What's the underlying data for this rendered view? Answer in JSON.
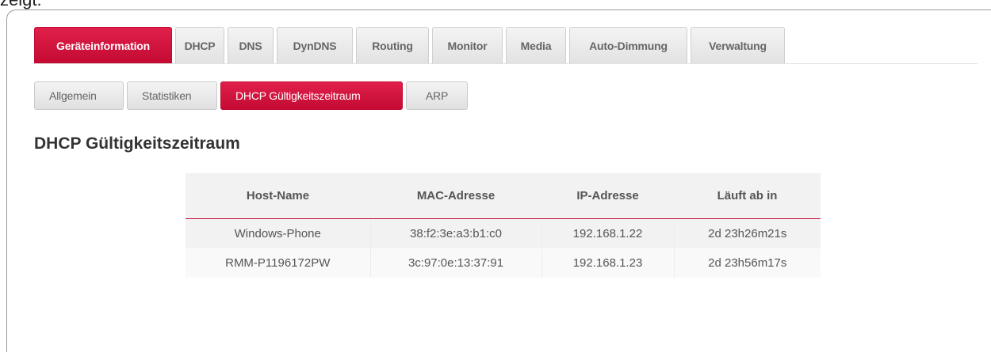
{
  "caption_fragment": "zeigt:",
  "main_tabs": [
    {
      "label": "Geräteinformation",
      "active": true
    },
    {
      "label": "DHCP",
      "active": false
    },
    {
      "label": "DNS",
      "active": false
    },
    {
      "label": "DynDNS",
      "active": false
    },
    {
      "label": "Routing",
      "active": false
    },
    {
      "label": "Monitor",
      "active": false
    },
    {
      "label": "Media",
      "active": false
    },
    {
      "label": "Auto-Dimmung",
      "active": false
    },
    {
      "label": "Verwaltung",
      "active": false
    }
  ],
  "sub_tabs": [
    {
      "label": "Allgemein",
      "active": false
    },
    {
      "label": "Statistiken",
      "active": false
    },
    {
      "label": "DHCP Gültigkeitszeitraum",
      "active": true
    },
    {
      "label": "ARP",
      "active": false
    }
  ],
  "section_title": "DHCP Gültigkeitszeitraum",
  "table": {
    "headers": [
      "Host-Name",
      "MAC-Adresse",
      "IP-Adresse",
      "Läuft ab in"
    ],
    "rows": [
      [
        "Windows-Phone",
        "38:f2:3e:a3:b1:c0",
        "192.168.1.22",
        "2d 23h26m21s"
      ],
      [
        "RMM-P1196172PW",
        "3c:97:0e:13:37:91",
        "192.168.1.23",
        "2d 23h56m17s"
      ]
    ]
  },
  "colors": {
    "accent": "#c30a32",
    "tab_inactive": "#e6e6e6",
    "text": "#555555"
  }
}
